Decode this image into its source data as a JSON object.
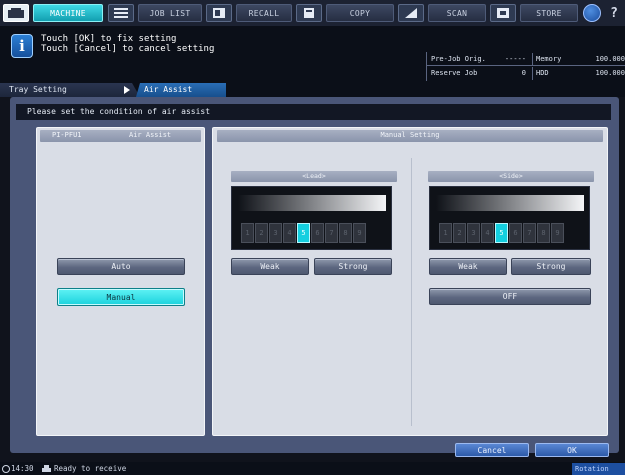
{
  "modebar": {
    "tabs": [
      {
        "label": "MACHINE",
        "icon": "machine-icon",
        "active": true
      },
      {
        "label": "JOB LIST",
        "icon": "job-list-icon",
        "active": false
      },
      {
        "label": "RECALL",
        "icon": "recall-icon",
        "active": false
      },
      {
        "label": "COPY",
        "icon": "copy-icon",
        "active": false
      },
      {
        "label": "SCAN",
        "icon": "scan-icon",
        "active": false
      },
      {
        "label": "STORE",
        "icon": "store-icon",
        "active": false
      }
    ],
    "help_icon": "help-icon",
    "question_label": "?"
  },
  "message": {
    "icon_glyph": "i",
    "line1": "Touch [OK] to fix setting",
    "line2": "Touch [Cancel] to cancel setting"
  },
  "status": {
    "pre_job_label": "Pre-Job Orig.",
    "pre_job_value": "-----",
    "memory_label": "Memory",
    "memory_value": "100.000",
    "reserve_label": "Reserve Job",
    "reserve_value": "0",
    "hdd_label": "HDD",
    "hdd_value": "100.000"
  },
  "breadcrumb": {
    "parent": "Tray Setting",
    "current": "Air Assist"
  },
  "instruction": "Please set the condition of air assist",
  "left_panel": {
    "tray": "PI-PFU1",
    "title": "Air Assist",
    "auto_label": "Auto",
    "manual_label": "Manual",
    "selected": "Manual"
  },
  "right_panel": {
    "title": "Manual Setting",
    "lead": {
      "label": "<Lead>",
      "levels": [
        "1",
        "2",
        "3",
        "4",
        "5",
        "6",
        "7",
        "8",
        "9"
      ],
      "selected_level": 5,
      "weak_label": "Weak",
      "strong_label": "Strong"
    },
    "side": {
      "label": "<Side>",
      "levels": [
        "1",
        "2",
        "3",
        "4",
        "5",
        "6",
        "7",
        "8",
        "9"
      ],
      "selected_level": 5,
      "weak_label": "Weak",
      "strong_label": "Strong",
      "off_label": "OFF"
    }
  },
  "footer": {
    "cancel_label": "Cancel",
    "ok_label": "OK"
  },
  "statusbar": {
    "time": "14:30",
    "ready": "Ready to receive",
    "rotation": "Rotation"
  },
  "colors": {
    "accent": "#1bd2dd",
    "work_area": "#4a5678",
    "panel": "#d9dde6",
    "level_on": "#14cfe0"
  }
}
